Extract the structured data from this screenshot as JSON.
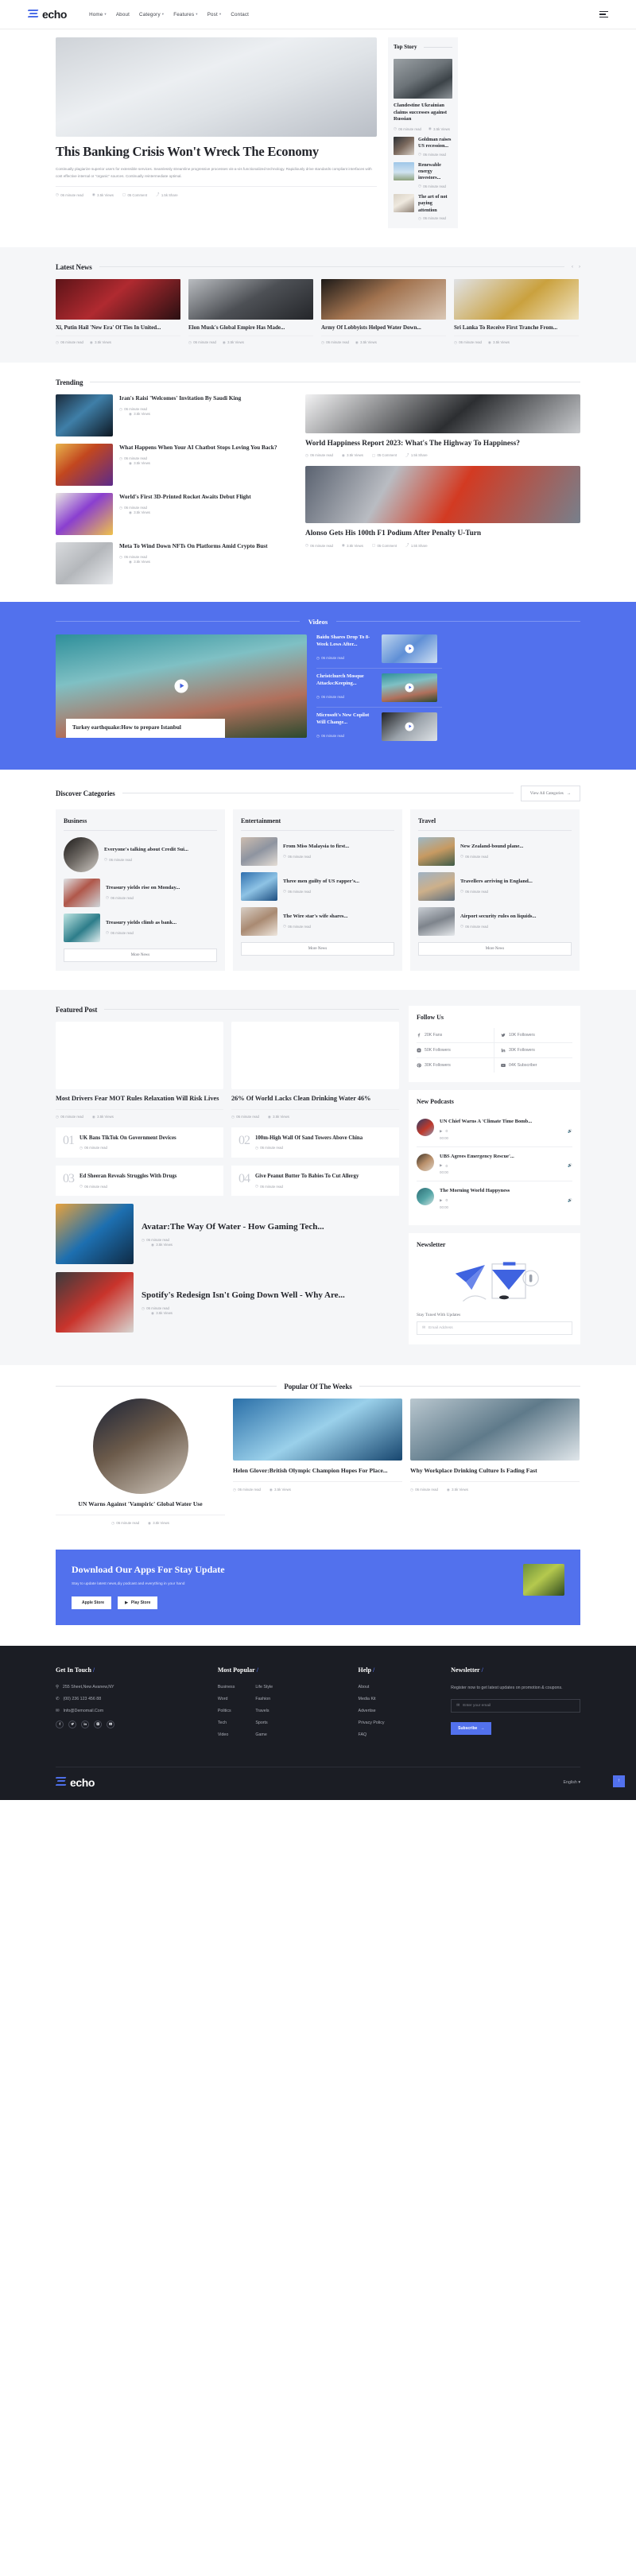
{
  "brand": {
    "name": "echo"
  },
  "nav": {
    "items": [
      {
        "label": "Home",
        "caret": true
      },
      {
        "label": "About",
        "caret": false
      },
      {
        "label": "Category",
        "caret": true
      },
      {
        "label": "Features",
        "caret": true
      },
      {
        "label": "Post",
        "caret": true
      },
      {
        "label": "Contact",
        "caret": false
      }
    ]
  },
  "hero": {
    "title": "This Banking Crisis Won't Wreck The Economy",
    "desc": "Continually plagiarize superior users for extensible services. Seamlessly streamline progressive processes vis-a-vis functionalized technology. Rapidiously drive standards compliant interfaces with cost effective internal or \"organic\" sources. Continually reintermediate optimal.",
    "meta": [
      "06 minute read",
      "3.5k Views",
      "05 Comment",
      "1.5k Share"
    ]
  },
  "top_story": {
    "heading": "Top Story",
    "lead": {
      "title": "Clandestine Ukrainian claims successes against Russian",
      "meta": [
        "06 minute read",
        "3.5k Views"
      ]
    },
    "items": [
      {
        "title": "Goldman raises US recession...",
        "meta": "06 minute read"
      },
      {
        "title": "Renewable energy investors...",
        "meta": "06 minute read"
      },
      {
        "title": "The art of not paying attention",
        "meta": "06 minute read"
      }
    ]
  },
  "latest": {
    "heading": "Latest News",
    "cards": [
      {
        "title": "Xi, Putin Hail 'New Era' Of Ties In United...",
        "meta": [
          "06 minute read",
          "3.5k Views"
        ]
      },
      {
        "title": "Elon Musk's Global Empire Has Made...",
        "meta": [
          "06 minute read",
          "3.5k Views"
        ]
      },
      {
        "title": "Army Of Lobbyists Helped Water Down...",
        "meta": [
          "06 minute read",
          "3.5k Views"
        ]
      },
      {
        "title": "Sri Lanka To Receive First Tranche From...",
        "meta": [
          "06 minute read",
          "3.5k Views"
        ]
      }
    ]
  },
  "trending": {
    "heading": "Trending",
    "left": [
      {
        "title": "Iran's Raisi 'Welcomes' Invitation By Saudi King",
        "meta": [
          "06 minute read",
          "3.5k Views"
        ]
      },
      {
        "title": "What Happens When Your AI Chatbot Stops Loving You Back?",
        "meta": [
          "06 minute read",
          "3.5k Views"
        ]
      },
      {
        "title": "World's First 3D-Printed Rocket Awaits Debut Flight",
        "meta": [
          "06 minute read",
          "3.5k Views"
        ]
      },
      {
        "title": "Meta To Wind Down NFTs On Platforms Amid Crypto Bust",
        "meta": [
          "06 minute read",
          "3.5k Views"
        ]
      }
    ],
    "right": [
      {
        "title": "World Happiness Report 2023: What's The Highway To Happiness?",
        "meta": [
          "06 minute read",
          "3.5k Views",
          "05 Comment",
          "1.5k Share"
        ]
      },
      {
        "title": "Alonso Gets His 100th F1 Podium After Penalty U-Turn",
        "meta": [
          "06 minute read",
          "3.5k Views",
          "05 Comment",
          "1.5k Share"
        ]
      }
    ]
  },
  "videos": {
    "heading": "Videos",
    "main": {
      "title": "Turkey earthquake:How to prepare Istanbul",
      "meta": "06 minute read"
    },
    "side": [
      {
        "title": "Baidu Shares Drop To 8-Week Lows After...",
        "meta": "06 minute read"
      },
      {
        "title": "Christchurch Mosque Attacks:Keeping...",
        "meta": "06 minute read"
      },
      {
        "title": "Microsoft's New Copilot Will Change...",
        "meta": "06 minute read"
      }
    ]
  },
  "categories": {
    "heading": "Discover Categories",
    "view_all": "View All Categories",
    "more_label": "More News",
    "columns": [
      {
        "name": "Business",
        "items": [
          {
            "title": "Everyone's talking about Credit Sui...",
            "meta": "06 minute read"
          },
          {
            "title": "Treasury yields rise on Monday...",
            "meta": "06 minute read"
          },
          {
            "title": "Treasury yields climb as bank...",
            "meta": "06 minute read"
          }
        ]
      },
      {
        "name": "Entertainment",
        "items": [
          {
            "title": "From Miss Malaysia to first...",
            "meta": "06 minute read"
          },
          {
            "title": "Three men guilty of US rapper's...",
            "meta": "06 minute read"
          },
          {
            "title": "The Wire star's wife shares...",
            "meta": "06 minute read"
          }
        ]
      },
      {
        "name": "Travel",
        "items": [
          {
            "title": "New Zealand-bound plane...",
            "meta": "06 minute read"
          },
          {
            "title": "Travellers arriving in England...",
            "meta": "06 minute read"
          },
          {
            "title": "Airport security rules on liquids...",
            "meta": "06 minute read"
          }
        ]
      }
    ]
  },
  "featured": {
    "heading": "Featured Post",
    "cards": [
      {
        "title": "Most Drivers Fear MOT Rules Relaxation Will Risk Lives",
        "meta": [
          "06 minute read",
          "3.5k Views"
        ]
      },
      {
        "title": "26% Of World Lacks Clean Drinking Water 46%",
        "meta": [
          "06 minute read",
          "3.5k Views"
        ]
      }
    ],
    "numbered": [
      {
        "num": "01",
        "title": "UK Bans TikTok On Government Devices",
        "meta": "06 minute read"
      },
      {
        "num": "02",
        "title": "100m-High Wall Of Sand Towers Above China",
        "meta": "06 minute read"
      },
      {
        "num": "03",
        "title": "Ed Sheeran Reveals Struggles With Drugs",
        "meta": "06 minute read"
      },
      {
        "num": "04",
        "title": "Give Peanut Butter To Babies To Cut Allergy",
        "meta": "06 minute read"
      }
    ],
    "wide": [
      {
        "title": "Avatar:The Way Of Water - How Gaming Tech...",
        "meta": [
          "06 minute read",
          "3.5k Views"
        ]
      },
      {
        "title": "Spotify's Redesign Isn't Going Down Well - Why Are...",
        "meta": [
          "06 minute read",
          "3.5k Views"
        ]
      }
    ]
  },
  "follow": {
    "heading": "Follow Us",
    "items": [
      {
        "icon": "facebook",
        "label": "20K Fans"
      },
      {
        "icon": "twitter",
        "label": "10K Followers"
      },
      {
        "icon": "instagram",
        "label": "50K Followers"
      },
      {
        "icon": "linkedin",
        "label": "30K Followers"
      },
      {
        "icon": "pinterest",
        "label": "30K Followers"
      },
      {
        "icon": "youtube",
        "label": "04K Subscriber"
      }
    ]
  },
  "podcasts": {
    "heading": "New Podcasts",
    "items": [
      {
        "title": "UN Chief Warns A 'Climate Time Bomb...",
        "time": "00:00"
      },
      {
        "title": "UBS Agrees Emergency Rescue'...",
        "time": "00:00"
      },
      {
        "title": "The Morning World Happyness",
        "time": "00:00"
      }
    ]
  },
  "newsletter_panel": {
    "heading": "Newsletter",
    "subtitle": "Stay Tuned With Updates",
    "placeholder": "Email Address"
  },
  "popular": {
    "heading": "Popular Of The Weeks",
    "cards": [
      {
        "title": "UN Warns Against 'Vampiric' Global Water Use",
        "meta": [
          "06 minute read",
          "3.5k Views"
        ]
      },
      {
        "title": "Helen Glover:British Olympic Champion Hopes For Place...",
        "meta": [
          "06 minute read",
          "3.5k Views"
        ]
      },
      {
        "title": "Why Workplace Drinking Culture Is Fading Fast",
        "meta": [
          "06 minute read",
          "3.5k Views"
        ]
      }
    ]
  },
  "cta": {
    "title": "Download Our Apps For Stay Update",
    "desc": "Stay to update latest news,diy podcast and everything in your hand",
    "apple": "Apple Store",
    "play": "Play Store"
  },
  "footer": {
    "contact": {
      "heading": "Get In Touch",
      "address": "255 Sheet,New Avanew,NY",
      "phone": "(00) 236 123 456 88",
      "email": "Info@Demomail.Com",
      "socials": [
        "facebook",
        "twitter",
        "linkedin",
        "instagram",
        "youtube"
      ]
    },
    "popular": {
      "heading": "Most Popular",
      "col_a": [
        "Business",
        "Word",
        "Politics",
        "Tech",
        "Video"
      ],
      "col_b": [
        "Life Style",
        "Fashion",
        "Travels",
        "Sports",
        "Game"
      ]
    },
    "help": {
      "heading": "Help",
      "links": [
        "About",
        "Media Kit",
        "Advertise",
        "Privacy Policy",
        "FAQ"
      ]
    },
    "newsletter": {
      "heading": "Newsletter",
      "note": "Register now to get latest updates on promotion & coupons.",
      "placeholder": "Enter your email",
      "button": "Subscribe"
    },
    "language": "English"
  }
}
